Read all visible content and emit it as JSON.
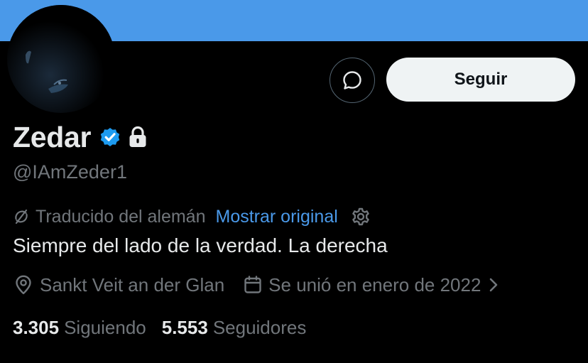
{
  "profile": {
    "name": "Zedar",
    "handle": "@IAmZeder1",
    "translated_label": "Traducido del alemán",
    "show_original_label": "Mostrar original",
    "bio": "Siempre del lado de la verdad. La derecha",
    "location": "Sankt Veit an der Glan",
    "joined": "Se unió en enero de 2022",
    "following_count": "3.305",
    "following_label": "Siguiendo",
    "followers_count": "5.553",
    "followers_label": "Seguidores"
  },
  "actions": {
    "follow_label": "Seguir"
  },
  "icons": {
    "message": "message-icon",
    "verified": "verified-badge-icon",
    "lock": "lock-icon",
    "translate": "translate-icon",
    "settings": "gear-icon",
    "location": "location-pin-icon",
    "calendar": "calendar-icon",
    "chevron": "chevron-right-icon"
  },
  "colors": {
    "banner": "#4a99e9",
    "background": "#000000",
    "accent": "#1d9bf0",
    "link": "#4a99e9",
    "muted": "#71767b",
    "follow_button": "#eff3f4"
  }
}
